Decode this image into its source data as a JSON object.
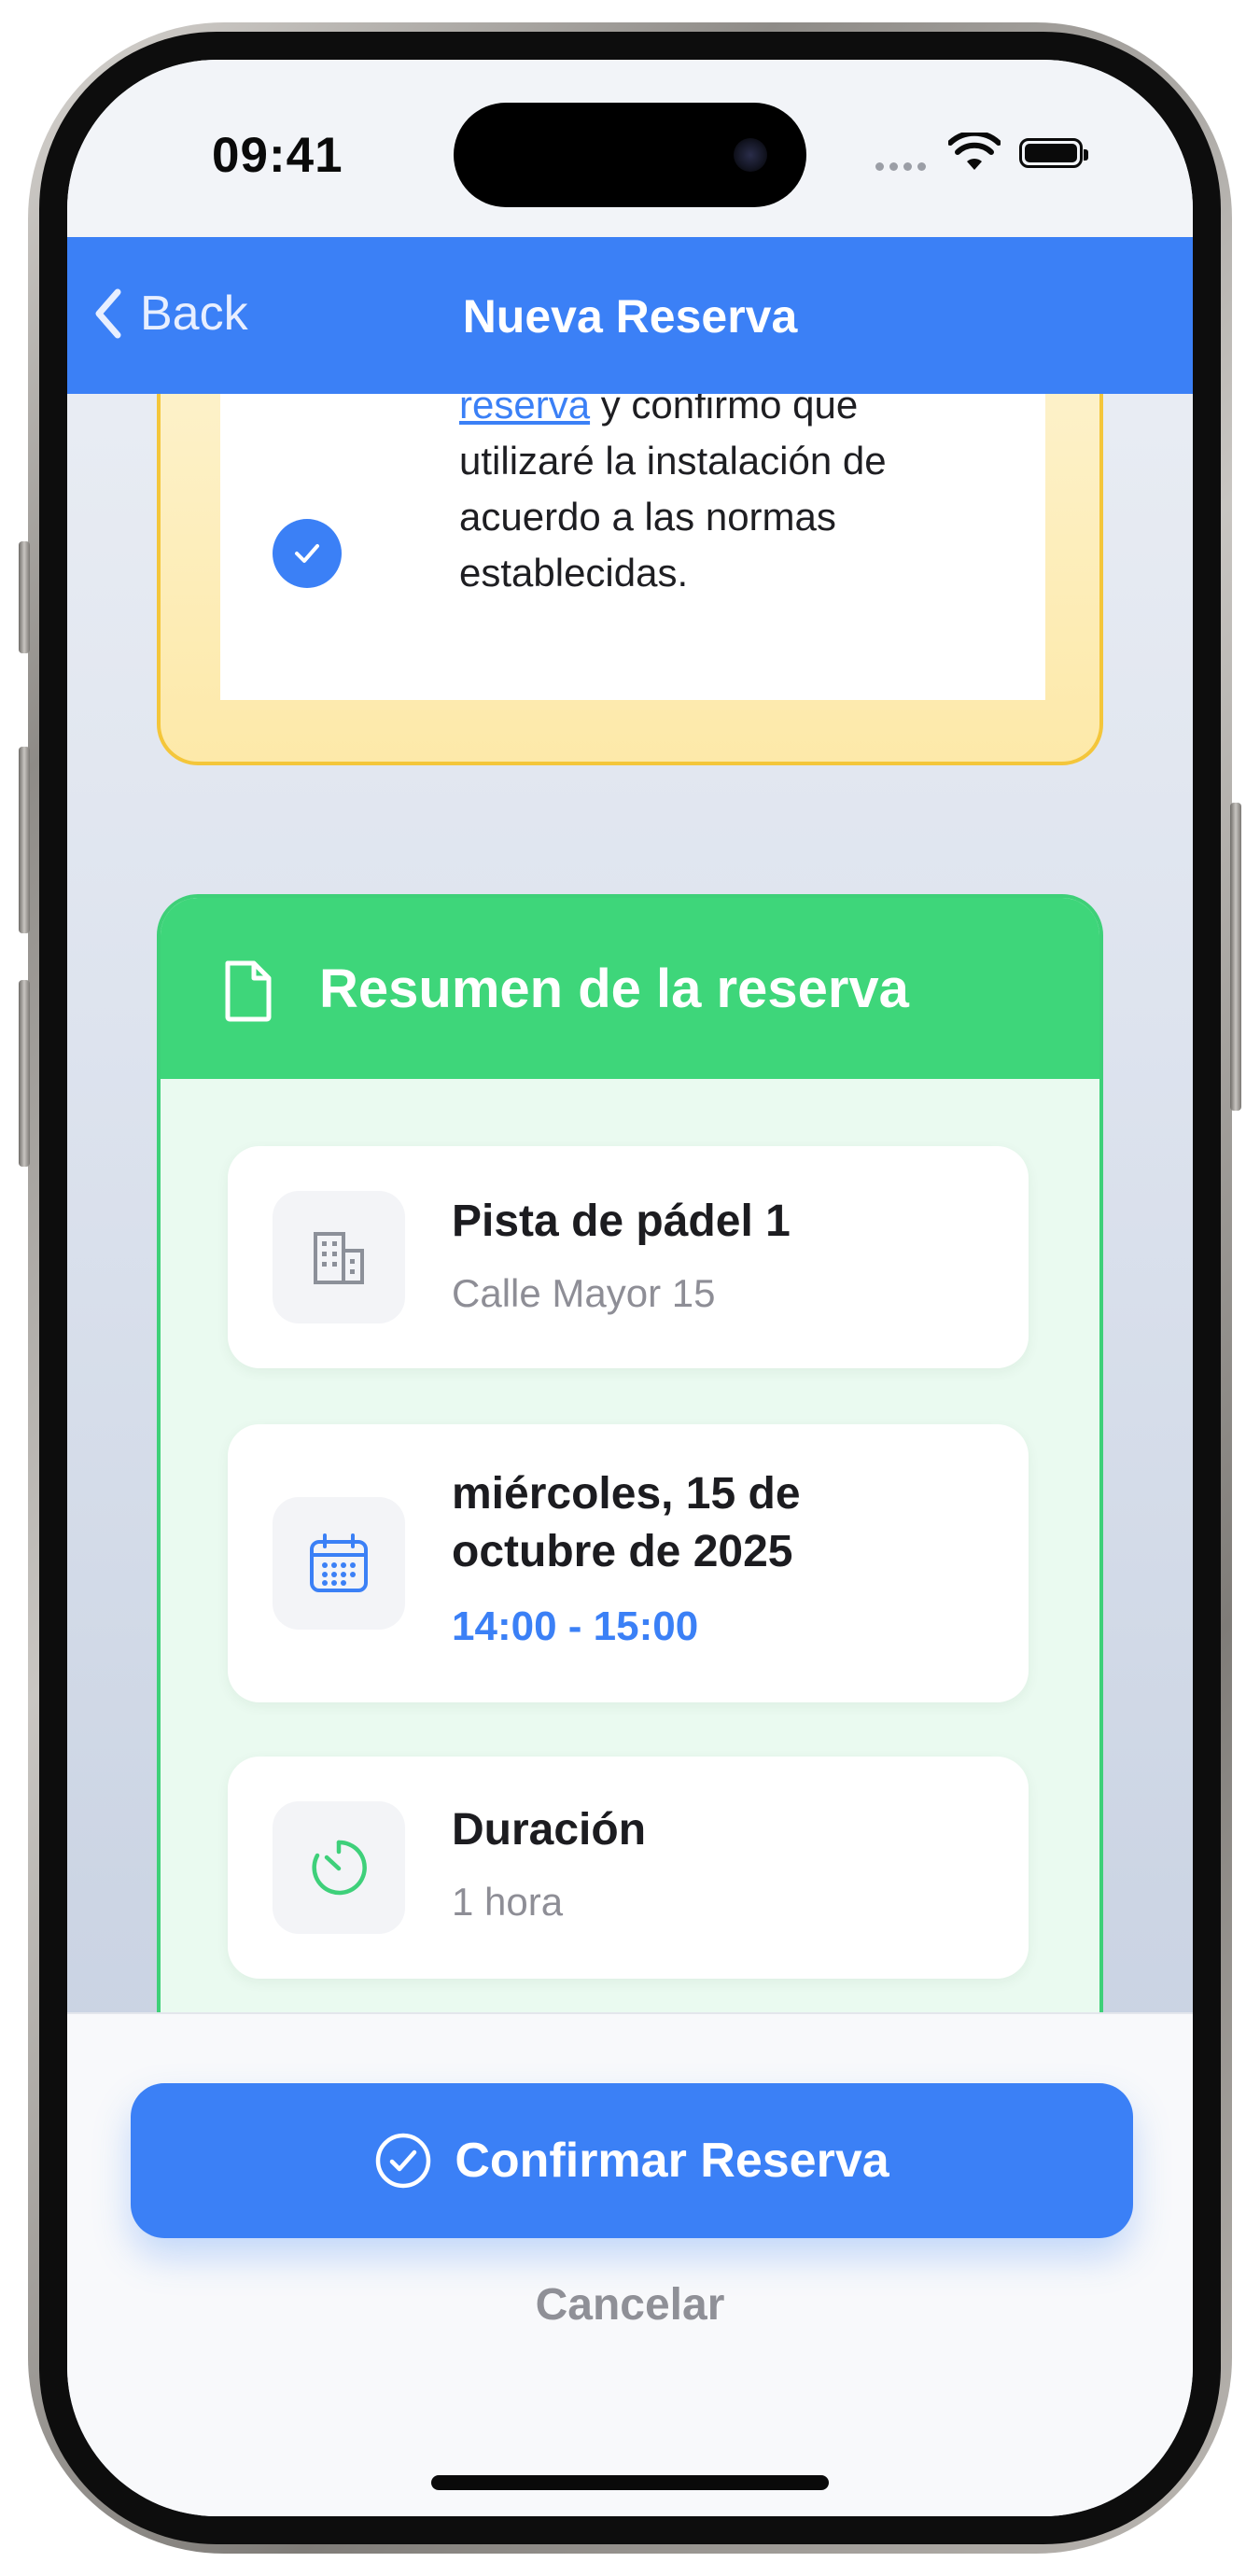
{
  "status_bar": {
    "time": "09:41"
  },
  "nav": {
    "back_label": "Back",
    "title": "Nueva Reserva"
  },
  "terms": {
    "link_text": "reserva",
    "text_after_link": " y confirmo que utilizaré la instalación de acuerdo a las normas establecidas.",
    "checked": true
  },
  "summary": {
    "title": "Resumen de la reserva",
    "facility": {
      "name": "Pista de pádel 1",
      "address": "Calle Mayor 15",
      "icon": "building-icon"
    },
    "date": {
      "date_text": "miércoles, 15 de octubre de 2025",
      "time_range": "14:00 - 15:00",
      "icon": "calendar-icon"
    },
    "duration": {
      "label": "Duración",
      "value": "1 hora",
      "icon": "timer-icon"
    }
  },
  "actions": {
    "confirm_label": "Confirmar Reserva",
    "cancel_label": "Cancelar"
  },
  "colors": {
    "primary": "#3b80f6",
    "success": "#3ed67a",
    "warning_border": "#f4c63a"
  }
}
